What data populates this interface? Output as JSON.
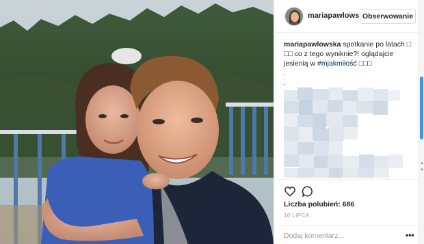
{
  "post": {
    "username": "mariapawlowsl",
    "follow_label": "Obserwowanie",
    "caption": {
      "username": "mariapawlowska",
      "text_before": " spotkanie po latach □",
      "text_line2": "□□ co z tego wyniknie?! oglądajcie jesienią w ",
      "hashtag": "#mjakmiłość",
      "text_after": " □□□",
      "dot1": ".",
      "dot2": "."
    },
    "likes_label": "Liczba polubień: 686",
    "date": "10 LIPCA",
    "comment_placeholder": "Dodaj komentarz...",
    "more_label": "•••"
  },
  "icons": {
    "like": "heart-icon",
    "comment": "comment-icon",
    "more": "more-options-icon"
  },
  "colors": {
    "follow_border": "#dbdbdb",
    "hashtag": "#003569",
    "scroll_thumb": "#4a90e2"
  }
}
